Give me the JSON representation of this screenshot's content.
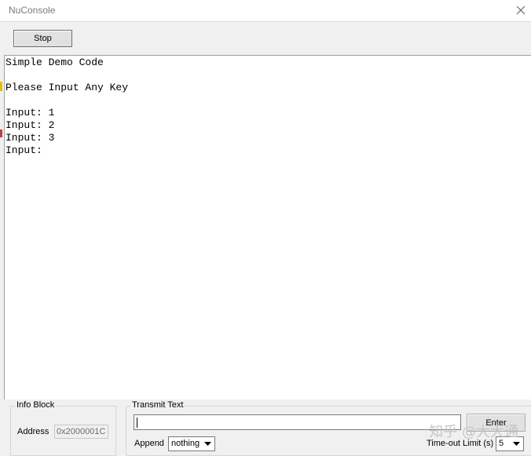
{
  "window": {
    "title": "NuConsole"
  },
  "toolbar": {
    "stop_label": "Stop"
  },
  "console": {
    "lines": [
      "Simple Demo Code",
      "",
      "Please Input Any Key",
      "",
      "Input: 1",
      "Input: 2",
      "Input: 3",
      "Input:"
    ]
  },
  "info_block": {
    "title": "Info Block",
    "address_label": "Address",
    "address_value": "0x2000001C"
  },
  "transmit": {
    "title": "Transmit Text",
    "input_value": "",
    "enter_label": "Enter",
    "append_label": "Append",
    "append_value": "nothing",
    "timeout_label": "Time-out Limit (s)",
    "timeout_value": "5"
  },
  "watermark": "知乎 @大大通",
  "colors": {
    "console_bg": "#ffffff",
    "window_bg": "#f0f0f0",
    "title_text": "#7a7a7a"
  },
  "icons": {
    "close": "close-icon",
    "dropdown": "chevron-down-icon"
  }
}
